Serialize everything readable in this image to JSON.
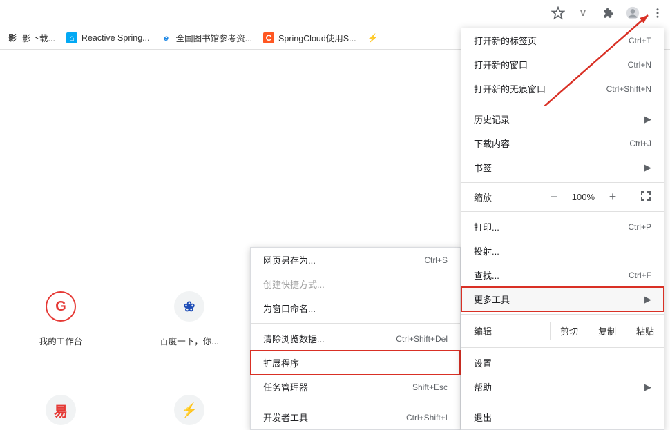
{
  "bookmarks": [
    {
      "icon_text": "影",
      "icon_bg": "#fff",
      "icon_color": "#333",
      "label": "影下载..."
    },
    {
      "icon_text": "⌂",
      "icon_bg": "#03a9f4",
      "icon_color": "#fff",
      "label": "Reactive Spring..."
    },
    {
      "icon_text": "e",
      "icon_bg": "#fff",
      "icon_color": "#1e88e5",
      "label": "全国图书馆参考资..."
    },
    {
      "icon_text": "C",
      "icon_bg": "#ff5722",
      "icon_color": "#fff",
      "label": "SpringCloud使用S..."
    },
    {
      "icon_text": "⚡",
      "icon_bg": "#fff",
      "icon_color": "#ff9800",
      "label": ""
    }
  ],
  "shortcuts_row1": [
    {
      "icon_text": "G",
      "icon_bg": "#fff",
      "icon_color": "#e53935",
      "border": "2px solid #e53935",
      "label": "我的工作台"
    },
    {
      "icon_text": "❀",
      "icon_bg": "#fff",
      "icon_color": "#1e4db7",
      "border": "none",
      "label": "百度一下，你..."
    }
  ],
  "shortcuts_row2": [
    {
      "icon_text": "易",
      "icon_bg": "#fff",
      "icon_color": "#e53935",
      "border": "none"
    },
    {
      "icon_text": "⚡",
      "icon_bg": "#fff",
      "icon_color": "#ff9800",
      "border": "none"
    }
  ],
  "main_menu": {
    "new_tab": {
      "label": "打开新的标签页",
      "key": "Ctrl+T"
    },
    "new_window": {
      "label": "打开新的窗口",
      "key": "Ctrl+N"
    },
    "new_incognito": {
      "label": "打开新的无痕窗口",
      "key": "Ctrl+Shift+N"
    },
    "history": {
      "label": "历史记录"
    },
    "downloads": {
      "label": "下载内容",
      "key": "Ctrl+J"
    },
    "bookmarks_menu": {
      "label": "书签"
    },
    "zoom": {
      "label": "缩放",
      "percent": "100%"
    },
    "print": {
      "label": "打印...",
      "key": "Ctrl+P"
    },
    "cast": {
      "label": "投射..."
    },
    "find": {
      "label": "查找...",
      "key": "Ctrl+F"
    },
    "more_tools": {
      "label": "更多工具"
    },
    "edit": {
      "label": "编辑",
      "cut": "剪切",
      "copy": "复制",
      "paste": "粘贴"
    },
    "settings": {
      "label": "设置"
    },
    "help": {
      "label": "帮助"
    },
    "exit": {
      "label": "退出"
    }
  },
  "submenu": {
    "save_as": {
      "label": "网页另存为...",
      "key": "Ctrl+S"
    },
    "create_shortcut": {
      "label": "创建快捷方式..."
    },
    "name_window": {
      "label": "为窗口命名..."
    },
    "clear_data": {
      "label": "清除浏览数据...",
      "key": "Ctrl+Shift+Del"
    },
    "extensions": {
      "label": "扩展程序"
    },
    "task_manager": {
      "label": "任务管理器",
      "key": "Shift+Esc"
    },
    "dev_tools": {
      "label": "开发者工具",
      "key": "Ctrl+Shift+I"
    }
  }
}
